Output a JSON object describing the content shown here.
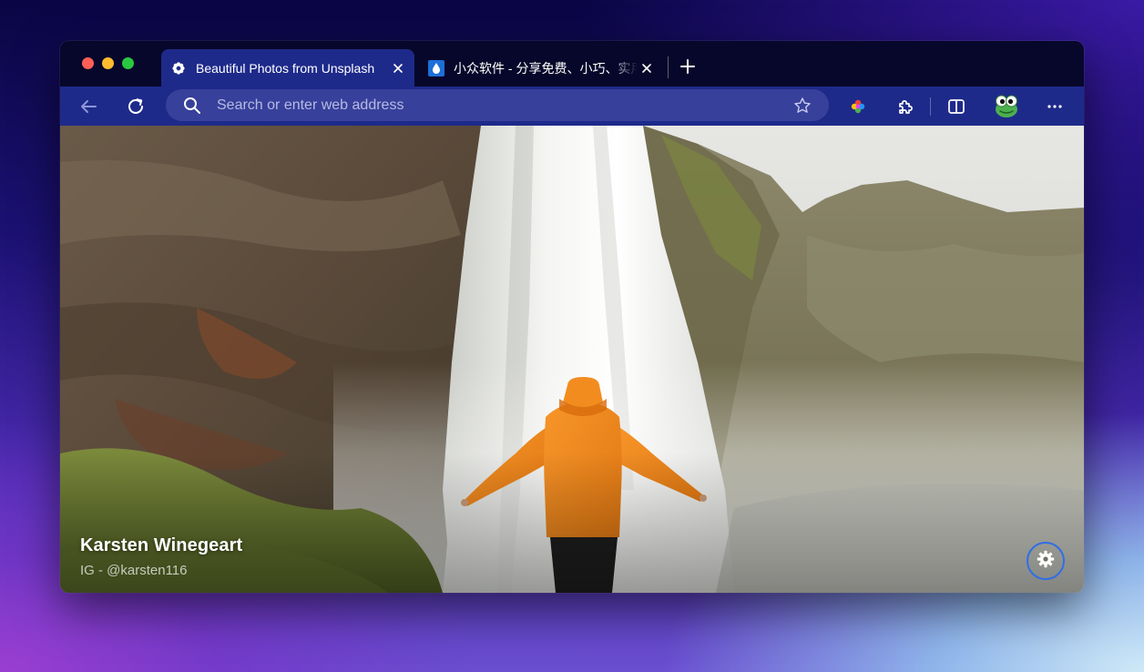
{
  "browser": {
    "tabs": [
      {
        "title": "Beautiful Photos from Unsplash",
        "icon": "gear-flower-icon",
        "active": true
      },
      {
        "title": "小众软件 - 分享免费、小巧、实用",
        "icon": "water-drop-icon",
        "active": false
      }
    ],
    "address_bar": {
      "placeholder": "Search or enter web address",
      "value": ""
    },
    "toolbar_icons": [
      "back-arrow-icon",
      "refresh-icon",
      "search-icon",
      "star-icon",
      "pinwheel-extension-icon",
      "extensions-puzzle-icon",
      "split-screen-icon",
      "profile-avatar-icon",
      "more-menu-icon"
    ]
  },
  "page": {
    "photographer": "Karsten Winegeart",
    "handle": "IG - @karsten116"
  },
  "colors": {
    "tabbar": "#07072b",
    "toolbar": "#1e2a8a",
    "omnibox": "#37409a",
    "settings_ring": "#2f6fe6"
  }
}
